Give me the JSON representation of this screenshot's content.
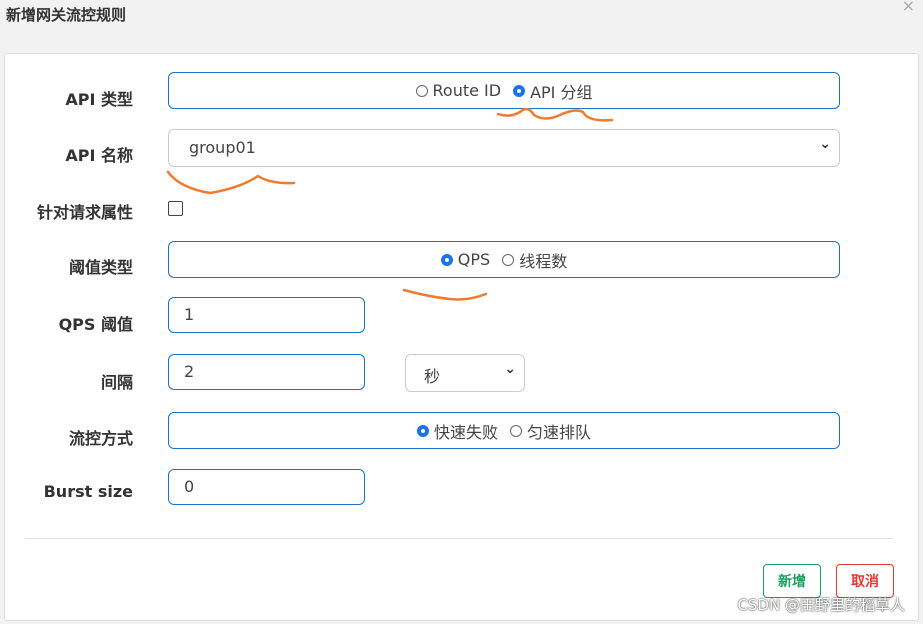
{
  "dialog": {
    "title": "新增网关流控规则",
    "close_glyph": "×"
  },
  "form": {
    "api_type": {
      "label": "API 类型",
      "options": [
        "Route ID",
        "API 分组"
      ],
      "selected": "API 分组"
    },
    "api_name": {
      "label": "API 名称",
      "value": "group01"
    },
    "request_attr": {
      "label": "针对请求属性",
      "checked": false
    },
    "threshold_type": {
      "label": "阈值类型",
      "options": [
        "QPS",
        "线程数"
      ],
      "selected": "QPS"
    },
    "qps_threshold": {
      "label": "QPS 阈值",
      "value": "1"
    },
    "interval": {
      "label": "间隔",
      "value": "2",
      "unit": "秒"
    },
    "control_mode": {
      "label": "流控方式",
      "options": [
        "快速失败",
        "匀速排队"
      ],
      "selected": "快速失败"
    },
    "burst_size": {
      "label": "Burst size",
      "value": "0"
    }
  },
  "buttons": {
    "add": "新增",
    "cancel": "取消"
  },
  "watermark": "CSDN @田野里的稻草人",
  "colors": {
    "accent": "#1a73c6",
    "add_button": "#1aa260",
    "cancel_button": "#e53935",
    "annotation": "#f07a2e"
  }
}
